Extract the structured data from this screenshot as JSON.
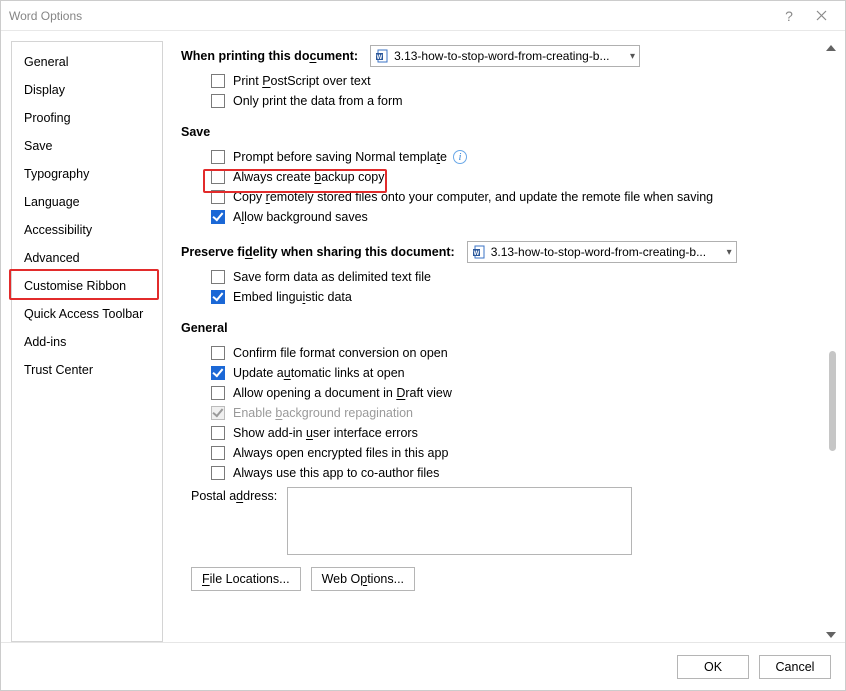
{
  "title": "Word Options",
  "sidebar": {
    "items": [
      {
        "label": "General"
      },
      {
        "label": "Display"
      },
      {
        "label": "Proofing"
      },
      {
        "label": "Save"
      },
      {
        "label": "Typography"
      },
      {
        "label": "Language"
      },
      {
        "label": "Accessibility"
      },
      {
        "label": "Advanced",
        "selected": true
      },
      {
        "label": "Customise Ribbon"
      },
      {
        "label": "Quick Access Toolbar"
      },
      {
        "label": "Add-ins"
      },
      {
        "label": "Trust Center"
      }
    ]
  },
  "content": {
    "printing_label_pre": "When printing this do",
    "printing_label_u": "c",
    "printing_label_post": "ument:",
    "printing_doc": "3.13-how-to-stop-word-from-creating-b...",
    "print_postscript_pre": "Print ",
    "print_postscript_u": "P",
    "print_postscript_post": "ostScript over text",
    "print_formdata": "Only print the data from a form",
    "save_head": "Save",
    "save_prompt_pre": "Prompt before saving Normal templa",
    "save_prompt_u": "t",
    "save_prompt_post": "e",
    "save_backup_pre": "Always create ",
    "save_backup_u": "b",
    "save_backup_post": "ackup copy",
    "save_copyremote_pre": "Copy ",
    "save_copyremote_u": "r",
    "save_copyremote_post": "emotely stored files onto your computer, and update the remote file when saving",
    "save_bg_pre": "A",
    "save_bg_u": "l",
    "save_bg_post": "low background saves",
    "preserve_label_pre": "Preserve fi",
    "preserve_label_u": "d",
    "preserve_label_post": "elity when sharing this document:",
    "preserve_doc": "3.13-how-to-stop-word-from-creating-b...",
    "preserve_saveform": "Save form data as delimited text file",
    "preserve_embed_pre": "Embed lingu",
    "preserve_embed_u": "i",
    "preserve_embed_post": "stic data",
    "general_head": "General",
    "gen_confirm": "Confirm file format conversion on open",
    "gen_update_pre": "Update a",
    "gen_update_u": "u",
    "gen_update_post": "tomatic links at open",
    "gen_draft_pre": "Allow opening a document in ",
    "gen_draft_u": "D",
    "gen_draft_post": "raft view",
    "gen_repag_pre": "Enable ",
    "gen_repag_u": "b",
    "gen_repag_post": "ackground repagination",
    "gen_showerr_pre": "Show add-in ",
    "gen_showerr_u": "u",
    "gen_showerr_post": "ser interface errors",
    "gen_encrypted": "Always open encrypted files in this app",
    "gen_coauthor": "Always use this app to co-author files",
    "gen_postal_pre": "Postal a",
    "gen_postal_u": "d",
    "gen_postal_post": "dress:",
    "btn_filelocations_pre": "",
    "btn_filelocations_u": "F",
    "btn_filelocations_post": "ile Locations...",
    "btn_weboptions_pre": "Web O",
    "btn_weboptions_u": "p",
    "btn_weboptions_post": "tions..."
  },
  "footer": {
    "ok": "OK",
    "cancel": "Cancel"
  }
}
